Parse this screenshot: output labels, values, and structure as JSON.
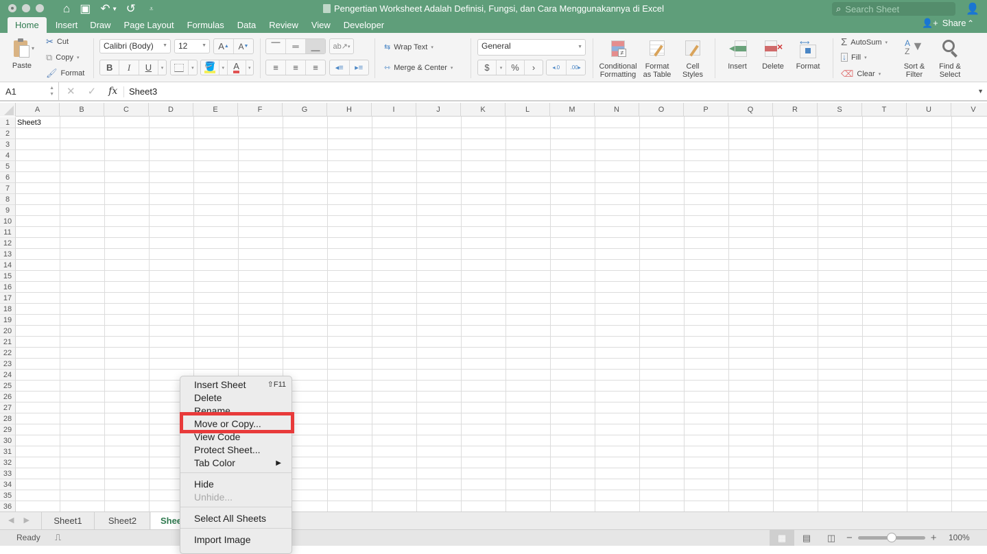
{
  "window": {
    "title": "Pengertian Worksheet Adalah Definisi, Fungsi, dan Cara Menggunakannya di Excel",
    "search_placeholder": "Search Sheet",
    "share_label": "Share"
  },
  "ribbon_tabs": [
    {
      "label": "Home",
      "active": true
    },
    {
      "label": "Insert"
    },
    {
      "label": "Draw"
    },
    {
      "label": "Page Layout"
    },
    {
      "label": "Formulas"
    },
    {
      "label": "Data"
    },
    {
      "label": "Review"
    },
    {
      "label": "View"
    },
    {
      "label": "Developer"
    }
  ],
  "ribbon": {
    "paste": "Paste",
    "cut": "Cut",
    "copy": "Copy",
    "format_painter": "Format",
    "font_name": "Calibri (Body)",
    "font_size": "12",
    "bold": "B",
    "italic": "I",
    "underline": "U",
    "wrap_text": "Wrap Text",
    "merge_center": "Merge & Center",
    "number_format": "General",
    "currency": "$",
    "percent": "%",
    "comma": "›",
    "conditional_formatting": [
      "Conditional",
      "Formatting"
    ],
    "format_as_table": [
      "Format",
      "as Table"
    ],
    "cell_styles": [
      "Cell",
      "Styles"
    ],
    "insert": "Insert",
    "delete": "Delete",
    "format": "Format",
    "autosum": "AutoSum",
    "fill": "Fill",
    "clear": "Clear",
    "sort_filter": [
      "Sort &",
      "Filter"
    ],
    "find_select": [
      "Find &",
      "Select"
    ]
  },
  "formula_bar": {
    "name_box": "A1",
    "fx": "fx",
    "value": "Sheet3"
  },
  "grid": {
    "columns": [
      "A",
      "B",
      "C",
      "D",
      "E",
      "F",
      "G",
      "H",
      "I",
      "J",
      "K",
      "L",
      "M",
      "N",
      "O",
      "P",
      "Q",
      "R",
      "S",
      "T",
      "U",
      "V"
    ],
    "rows": [
      "1",
      "2",
      "3",
      "4",
      "5",
      "6",
      "7",
      "8",
      "9",
      "10",
      "11",
      "12",
      "13",
      "14",
      "15",
      "16",
      "17",
      "18",
      "19",
      "20",
      "21",
      "22",
      "23",
      "24",
      "25",
      "26",
      "27",
      "28",
      "29",
      "30",
      "31",
      "32",
      "33",
      "34",
      "35",
      "36"
    ],
    "cells": {
      "A1": "Sheet3"
    }
  },
  "sheet_tabs": [
    {
      "label": "Sheet1"
    },
    {
      "label": "Sheet2"
    },
    {
      "label": "Shee",
      "active": true
    }
  ],
  "status": {
    "ready": "Ready",
    "zoom": "100%",
    "zoom_fraction": 0.5
  },
  "context_menu": {
    "items": [
      {
        "label": "Insert Sheet",
        "shortcut": "⇧F11"
      },
      {
        "label": "Delete"
      },
      {
        "label": "Rename"
      },
      {
        "label": "Move or Copy...",
        "highlighted": true
      },
      {
        "label": "View Code"
      },
      {
        "label": "Protect Sheet..."
      },
      {
        "label": "Tab Color",
        "submenu": "▶"
      },
      {
        "label": "Hide"
      },
      {
        "label": "Unhide...",
        "disabled": true
      },
      {
        "label": "Select All Sheets"
      },
      {
        "label": "Import Image"
      }
    ]
  },
  "colors": {
    "titlebar": "#5f9e7a",
    "accent": "#2f7a4f",
    "highlight_box": "#e83a3a"
  }
}
